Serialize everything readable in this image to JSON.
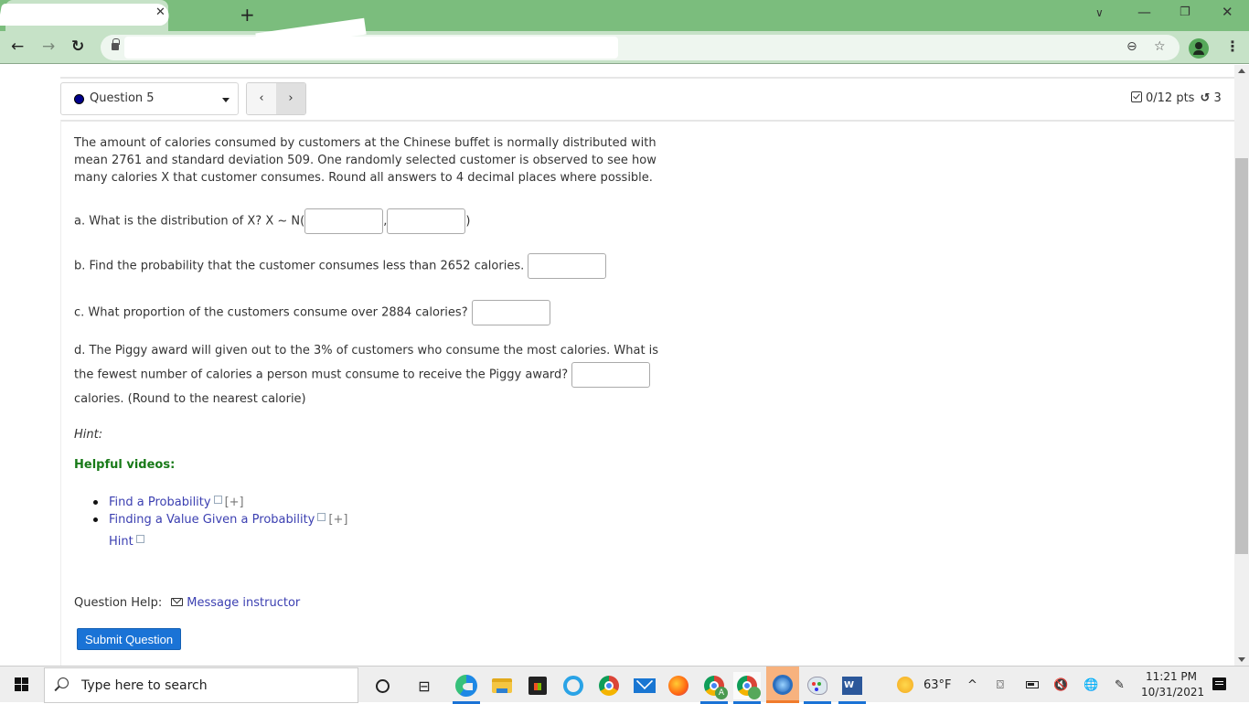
{
  "browser": {
    "tab_title": "",
    "new_tab_label": "+",
    "window_controls": [
      "tab-search",
      "minimize",
      "restore",
      "close"
    ],
    "url": "",
    "icons": {
      "back": "←",
      "forward": "→",
      "reload": "↻",
      "zoom": "⊖",
      "bookmark": "☆",
      "menu": "⋮",
      "close": "✕",
      "minimize": "—",
      "restore": "❐",
      "tab_search": "∨"
    }
  },
  "question_nav": {
    "selected": "Question 5",
    "prev_label": "‹",
    "next_label": "›",
    "score": "0/12 pts",
    "retry_icon": "↺",
    "attempts": "3"
  },
  "question": {
    "intro": "The amount of calories consumed by customers at the Chinese buffet is normally distributed with mean 2761 and standard deviation 509. One randomly selected customer is observed to see how many calories X that customer consumes. Round all answers to 4 decimal places where possible.",
    "part_a": {
      "prefix": "a. What is the distribution of X? X ~ N(",
      "separator": ",",
      "suffix": ")",
      "inputs": [
        "",
        ""
      ]
    },
    "part_b": {
      "text": "b. Find the probability that the customer consumes less than 2652 calories.",
      "input": ""
    },
    "part_c": {
      "text": "c. What proportion of the customers consume over 2884 calories?",
      "input": ""
    },
    "part_d": {
      "text": "d. The Piggy award will given out to the 3% of customers who consume the most calories. What is the fewest number of calories a person must consume to receive the Piggy award?",
      "input": "",
      "suffix": "calories. (Round to the nearest calorie)"
    }
  },
  "help": {
    "hint_label": "Hint:",
    "helpful_videos_label": "Helpful videos:",
    "videos": [
      {
        "title": "Find a Probability",
        "expand": "[+]"
      },
      {
        "title": "Finding a Value Given a Probability",
        "expand": "[+]"
      }
    ],
    "hint_link": "Hint",
    "question_help_label": "Question Help:",
    "message_instructor": "Message instructor",
    "submit_label": "Submit Question"
  },
  "colors": {
    "chrome_green": "#7bbd7d",
    "link": "#3b3fb1",
    "helpful_green": "#187a18",
    "submit_blue": "#1a73d6",
    "question_dot": "#00008b"
  },
  "taskbar": {
    "search_placeholder": "Type here to search",
    "task_view_icon": "⊟",
    "apps": [
      "edge",
      "file-explorer",
      "microsoft-store",
      "internet-explorer",
      "chrome",
      "mail",
      "firefox",
      "chrome-profile-a",
      "chrome-profile-b",
      "active-app",
      "paint",
      "word"
    ],
    "chrome_a_badge": "A",
    "word_letter": "W",
    "temperature": "63°F",
    "tray_chevron": "^",
    "volume_icon": "🔇",
    "network_icon": "🌐",
    "pen_icon": "✎",
    "meet_icon": "⌼",
    "time": "11:21 PM",
    "date": "10/31/2021"
  }
}
